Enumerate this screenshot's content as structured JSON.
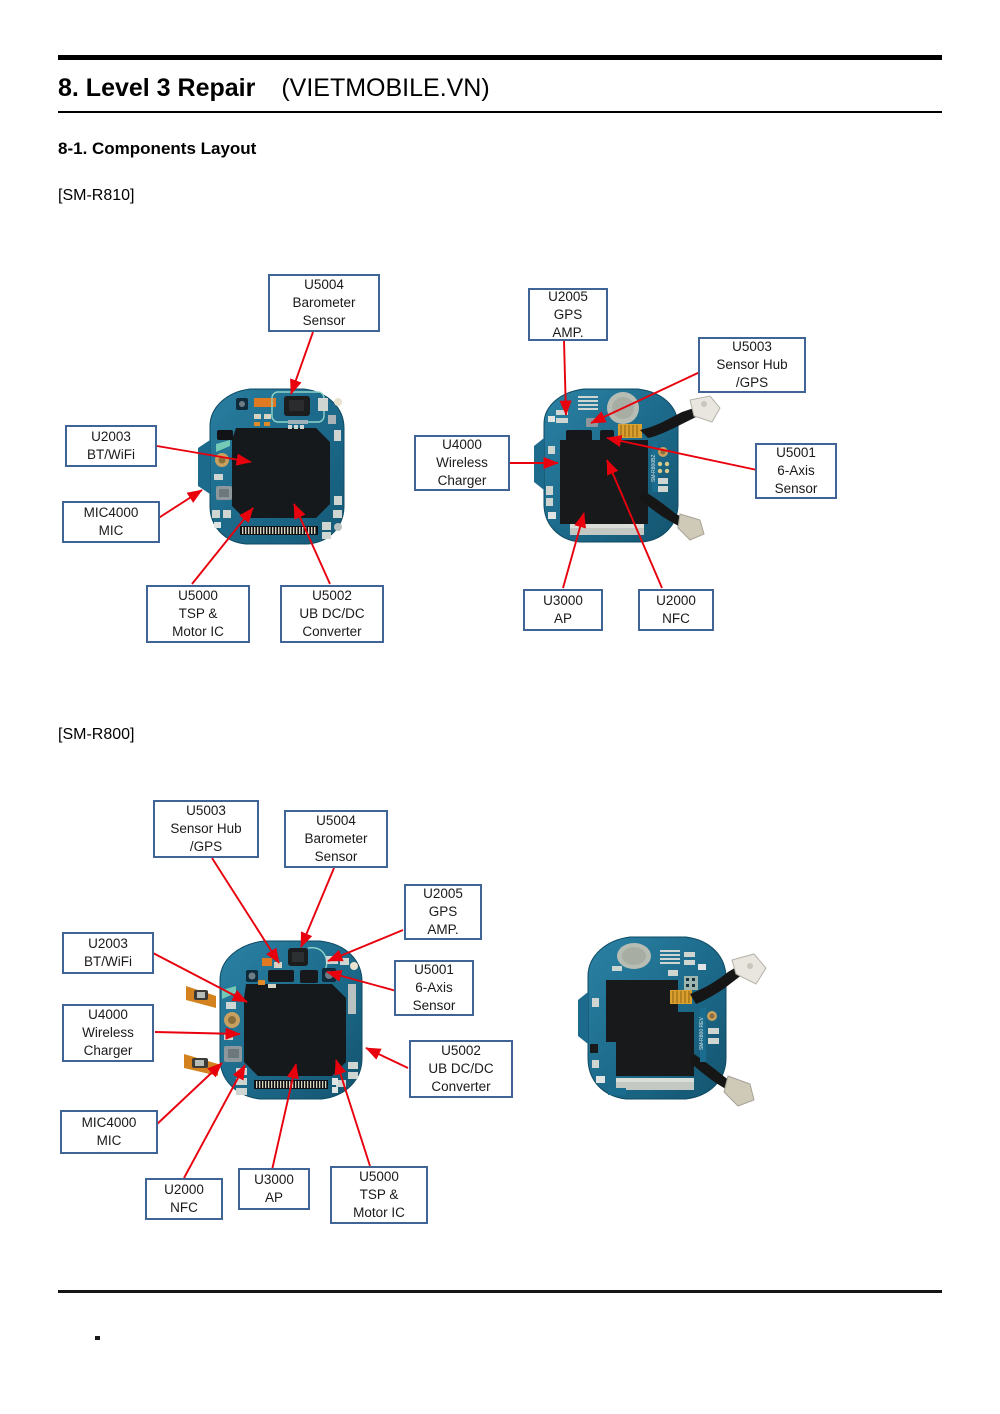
{
  "document": {
    "chapter_title": "8. Level 3 Repair",
    "site_tag": "(VIETMOBILE.VN)",
    "section_title": "8-1. Components Layout",
    "footer_mark": ""
  },
  "colors": {
    "callout_border": "#3f6495",
    "arrow_red": "#e8000d",
    "rule_black": "#000000",
    "pcb_blue": "#1e6f93",
    "pcb_dark": "#16191c"
  },
  "sections": [
    {
      "model": "[SM-R810]",
      "boards": [
        {
          "id": "r810-front",
          "view": "front",
          "callouts": [
            {
              "id": "u5004",
              "lines": [
                "U5004",
                "Barometer",
                "Sensor"
              ]
            },
            {
              "id": "u2003",
              "lines": [
                "U2003",
                "BT/WiFi"
              ]
            },
            {
              "id": "mic4000",
              "lines": [
                "MIC4000",
                "MIC"
              ]
            },
            {
              "id": "u5000",
              "lines": [
                "U5000",
                "TSP &",
                "Motor IC"
              ]
            },
            {
              "id": "u5002",
              "lines": [
                "U5002",
                "UB DC/DC",
                "Converter"
              ]
            }
          ]
        },
        {
          "id": "r810-back",
          "view": "back",
          "callouts": [
            {
              "id": "u2005",
              "lines": [
                "U2005",
                "GPS",
                "AMP."
              ]
            },
            {
              "id": "u5003",
              "lines": [
                "U5003",
                "Sensor Hub",
                "/GPS"
              ]
            },
            {
              "id": "u4000",
              "lines": [
                "U4000",
                "Wireless",
                "Charger"
              ]
            },
            {
              "id": "u5001",
              "lines": [
                "U5001",
                "6-Axis",
                "Sensor"
              ]
            },
            {
              "id": "u3000",
              "lines": [
                "U3000",
                "AP"
              ]
            },
            {
              "id": "u2000",
              "lines": [
                "U2000",
                "NFC"
              ]
            }
          ]
        }
      ]
    },
    {
      "model": "[SM-R800]",
      "boards": [
        {
          "id": "r800-front",
          "view": "front",
          "callouts": [
            {
              "id": "u5003",
              "lines": [
                "U5003",
                "Sensor Hub",
                "/GPS"
              ]
            },
            {
              "id": "u5004",
              "lines": [
                "U5004",
                "Barometer",
                "Sensor"
              ]
            },
            {
              "id": "u2005",
              "lines": [
                "U2005",
                "GPS",
                "AMP."
              ]
            },
            {
              "id": "u2003",
              "lines": [
                "U2003",
                "BT/WiFi"
              ]
            },
            {
              "id": "u5001",
              "lines": [
                "U5001",
                "6-Axis",
                "Sensor"
              ]
            },
            {
              "id": "u4000",
              "lines": [
                "U4000",
                "Wireless",
                "Charger"
              ]
            },
            {
              "id": "u5002",
              "lines": [
                "U5002",
                "UB DC/DC",
                "Converter"
              ]
            },
            {
              "id": "mic4000",
              "lines": [
                "MIC4000",
                "MIC"
              ]
            },
            {
              "id": "u2000",
              "lines": [
                "U2000",
                "NFC"
              ]
            },
            {
              "id": "u3000",
              "lines": [
                "U3000",
                "AP"
              ]
            },
            {
              "id": "u5000",
              "lines": [
                "U5000",
                "TSP &",
                "Motor IC"
              ]
            }
          ]
        },
        {
          "id": "r800-back",
          "view": "back",
          "callouts": []
        }
      ]
    }
  ]
}
